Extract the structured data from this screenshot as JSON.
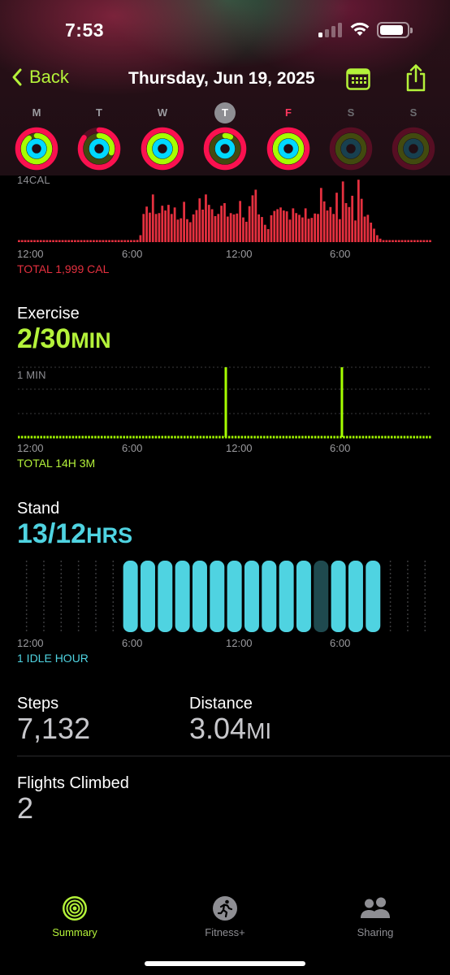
{
  "status_bar": {
    "time": "7:53",
    "signal_icon": "cellular-signal-icon",
    "wifi_icon": "wifi-icon",
    "battery_icon": "battery-icon"
  },
  "nav": {
    "back_label": "Back",
    "title": "Thursday, Jun 19, 2025",
    "calendar_icon": "calendar-icon",
    "share_icon": "share-icon"
  },
  "week": [
    {
      "letter": "M",
      "state": "past",
      "move": 1.0,
      "exercise": 0.9,
      "stand": 1.0
    },
    {
      "letter": "T",
      "state": "past",
      "move": 0.85,
      "exercise": 0.3,
      "stand": 1.0
    },
    {
      "letter": "W",
      "state": "past",
      "move": 1.0,
      "exercise": 1.0,
      "stand": 1.0
    },
    {
      "letter": "T",
      "state": "today",
      "move": 1.0,
      "exercise": 0.07,
      "stand": 1.0
    },
    {
      "letter": "F",
      "state": "past-highlight",
      "move": 1.0,
      "exercise": 1.0,
      "stand": 1.0
    },
    {
      "letter": "S",
      "state": "future",
      "move": 0,
      "exercise": 0,
      "stand": 0
    },
    {
      "letter": "S",
      "state": "future",
      "move": 0,
      "exercise": 0,
      "stand": 0
    }
  ],
  "colors": {
    "move": "#fa114f",
    "exercise": "#a6ff00",
    "stand": "#00d8ff",
    "accent": "#b4f23a",
    "move_bar": "#e5303f",
    "stand_bar": "#4fd3e1"
  },
  "move_chart": {
    "max_label": "14CAL",
    "x_labels": [
      "12:00",
      "6:00",
      "12:00",
      "6:00"
    ],
    "total": "TOTAL 1,999 CAL"
  },
  "exercise": {
    "title": "Exercise",
    "value": "2/30",
    "unit": "MIN",
    "max_label": "1 MIN",
    "x_labels": [
      "12:00",
      "6:00",
      "12:00",
      "6:00"
    ],
    "total": "TOTAL 14H 3M"
  },
  "stand": {
    "title": "Stand",
    "value": "13/12",
    "unit": "HRS",
    "x_labels": [
      "12:00",
      "6:00",
      "12:00",
      "6:00"
    ],
    "total": "1 IDLE HOUR"
  },
  "stats": {
    "steps_label": "Steps",
    "steps_value": "7,132",
    "distance_label": "Distance",
    "distance_value": "3.04",
    "distance_unit": "MI",
    "flights_label": "Flights Climbed",
    "flights_value": "2"
  },
  "tabs": [
    {
      "label": "Summary",
      "icon": "activity-rings-icon",
      "selected": true
    },
    {
      "label": "Fitness+",
      "icon": "fitness-plus-icon",
      "selected": false
    },
    {
      "label": "Sharing",
      "icon": "sharing-people-icon",
      "selected": false
    }
  ],
  "chart_data": [
    {
      "type": "bar",
      "title": "Move",
      "ylabel": "14CAL",
      "x_tick_labels": [
        "12:00",
        "6:00",
        "12:00",
        "6:00"
      ],
      "note": "TOTAL 1,999 CAL",
      "values": [
        0.3,
        0.3,
        0.3,
        0.3,
        0.3,
        0.3,
        0.3,
        0.3,
        0.3,
        0.3,
        0.3,
        0.3,
        0.3,
        0.3,
        0.3,
        0.3,
        0.3,
        0.3,
        0.3,
        0.3,
        0.3,
        0.3,
        0.3,
        0.3,
        0.3,
        0.3,
        0.3,
        0.3,
        0.3,
        0.3,
        0.3,
        0.3,
        0.3,
        0.3,
        0.3,
        0.3,
        0.3,
        0.3,
        0.5,
        1.6,
        6.5,
        8.2,
        6.8,
        11.0,
        6.5,
        6.7,
        8.4,
        7.3,
        8.6,
        6.5,
        8.0,
        5.2,
        5.5,
        9.3,
        5.3,
        4.6,
        6.4,
        7.4,
        10.1,
        7.5,
        11.0,
        8.6,
        7.6,
        6.0,
        6.5,
        8.4,
        9.0,
        5.9,
        6.7,
        6.4,
        6.6,
        9.5,
        5.7,
        4.7,
        8.3,
        10.8,
        12.1,
        6.4,
        5.8,
        4.0,
        3.0,
        6.2,
        7.2,
        7.6,
        8.0,
        7.3,
        7.1,
        5.2,
        7.8,
        6.7,
        6.3,
        5.7,
        7.8,
        5.4,
        5.6,
        6.6,
        6.5,
        12.5,
        9.4,
        7.3,
        8.1,
        6.5,
        11.4,
        5.3,
        14.0,
        9.0,
        8.1,
        10.7,
        5.0,
        14.4,
        10.0,
        5.9,
        6.3,
        4.5,
        3.1,
        1.6,
        0.8,
        0.3,
        0.3,
        0.3,
        0.3,
        0.3,
        0.3,
        0.3,
        0.3,
        0.3,
        0.3,
        0.3,
        0.3,
        0.3,
        0.3,
        0.3,
        0.3
      ],
      "ylim": [
        0,
        15
      ]
    },
    {
      "type": "bar",
      "title": "Exercise",
      "ylabel": "1 MIN",
      "x_tick_labels": [
        "12:00",
        "6:00",
        "12:00",
        "6:00"
      ],
      "note": "TOTAL 14H 3M",
      "hour_of_spikes": [
        12.0,
        18.7
      ],
      "spike_values": [
        1,
        1
      ],
      "ylim": [
        0,
        1
      ]
    },
    {
      "type": "bar",
      "title": "Stand",
      "x_tick_labels": [
        "12:00",
        "6:00",
        "12:00",
        "6:00"
      ],
      "note": "1 IDLE HOUR",
      "hours": [
        0,
        1,
        2,
        3,
        4,
        5,
        6,
        7,
        8,
        9,
        10,
        11,
        12,
        13,
        14,
        15,
        16,
        17,
        18,
        19,
        20,
        21,
        22,
        23
      ],
      "stood": [
        0,
        0,
        0,
        0,
        0,
        0,
        1,
        1,
        1,
        1,
        1,
        1,
        1,
        1,
        1,
        1,
        1,
        0,
        1,
        1,
        1,
        0,
        0,
        0
      ],
      "idle": [
        0,
        0,
        0,
        0,
        0,
        0,
        0,
        0,
        0,
        0,
        0,
        0,
        0,
        0,
        0,
        0,
        0,
        1,
        0,
        0,
        0,
        0,
        0,
        0
      ]
    }
  ]
}
